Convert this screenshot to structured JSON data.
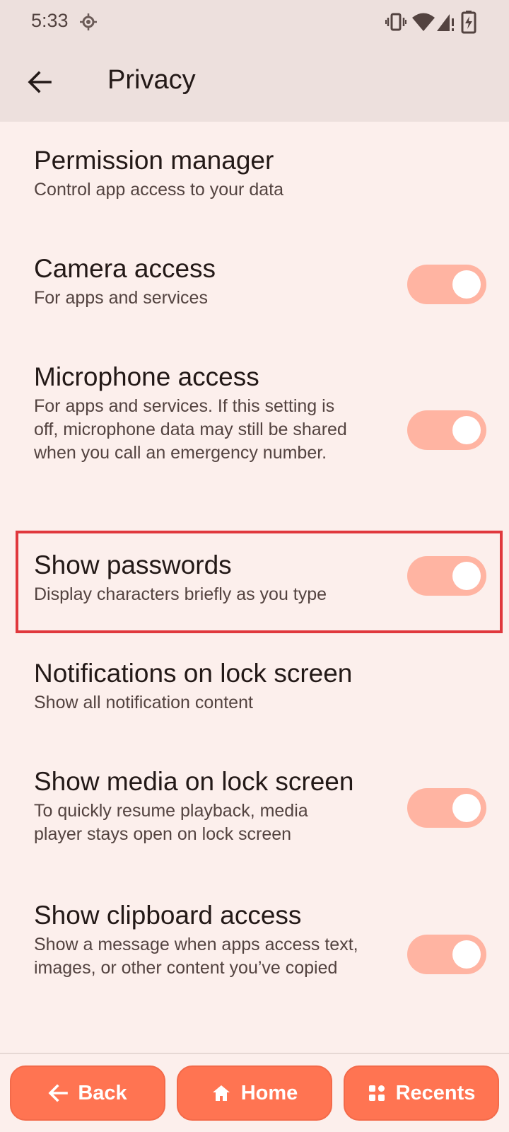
{
  "status_bar": {
    "time": "5:33",
    "icons": [
      "location-icon",
      "vibrate-icon",
      "wifi-icon",
      "signal-icon",
      "battery-charging-icon"
    ]
  },
  "app_bar": {
    "title": "Privacy",
    "back_icon": "arrow-back-icon"
  },
  "settings": [
    {
      "title": "Permission manager",
      "summary": "Control app access to your data",
      "has_toggle": false
    },
    {
      "title": "Camera access",
      "summary": "For apps and services",
      "has_toggle": true,
      "on": true
    },
    {
      "title": "Microphone access",
      "summary": "For apps and services. If this setting is off, microphone data may still be shared when you call an emergency number.",
      "has_toggle": true,
      "on": true
    },
    {
      "title": "Show passwords",
      "summary": "Display characters briefly as you type",
      "has_toggle": true,
      "on": true,
      "highlighted": true
    },
    {
      "title": "Notifications on lock screen",
      "summary": "Show all notification content",
      "has_toggle": false
    },
    {
      "title": "Show media on lock screen",
      "summary": "To quickly resume playback, media player stays open on lock screen",
      "has_toggle": true,
      "on": true
    },
    {
      "title": "Show clipboard access",
      "summary": "Show a message when apps access text, images, or other content you’ve copied",
      "has_toggle": true,
      "on": true
    }
  ],
  "bottom_nav": {
    "back_label": "Back",
    "home_label": "Home",
    "recents_label": "Recents"
  },
  "colors": {
    "background": "#fcefec",
    "app_bar": "#ede0dd",
    "toggle_track": "#ffb4a2",
    "nav_button": "#ff7452",
    "highlight": "#e0383d"
  }
}
